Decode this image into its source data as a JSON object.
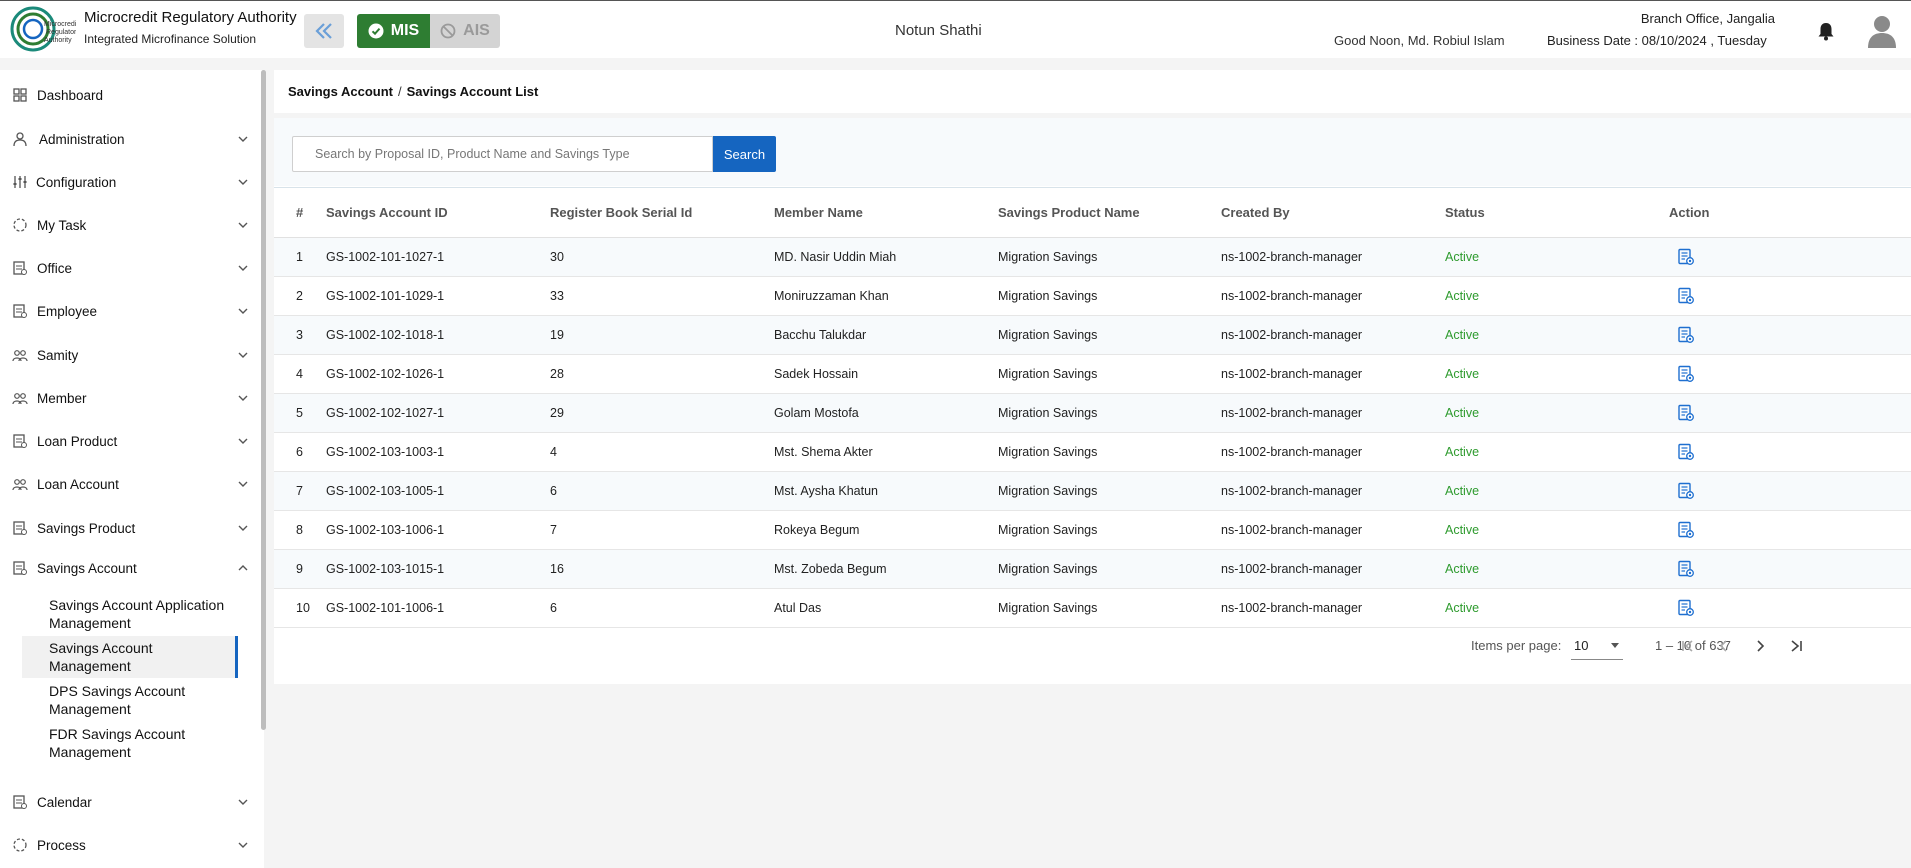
{
  "header": {
    "brand_title": "Microcredit Regulatory Authority",
    "brand_sub": "Integrated Microfinance Solution",
    "logo_text": "Microcredit Regulatory Authority",
    "mis_label": "MIS",
    "ais_label": "AIS",
    "org_name": "Notun Shathi",
    "greeting": "Good Noon, Md. Robiul Islam",
    "branch": "Branch Office, Jangalia",
    "business_date": "Business Date : 08/10/2024 , Tuesday",
    "colors": {
      "mis": "#2e7d32",
      "primary": "#1565c0"
    }
  },
  "sidebar": {
    "items": [
      {
        "label": "Dashboard",
        "icon": "dashboard-icon"
      },
      {
        "label": "Administration",
        "icon": "admin-icon"
      },
      {
        "label": "Configuration",
        "icon": "config-icon"
      },
      {
        "label": "My Task",
        "icon": "task-icon"
      },
      {
        "label": "Office",
        "icon": "office-icon"
      },
      {
        "label": "Employee",
        "icon": "employee-icon"
      },
      {
        "label": "Samity",
        "icon": "samity-icon"
      },
      {
        "label": "Member",
        "icon": "member-icon"
      },
      {
        "label": "Loan Product",
        "icon": "loan-product-icon"
      },
      {
        "label": "Loan Account",
        "icon": "loan-account-icon"
      },
      {
        "label": "Savings Product",
        "icon": "savings-product-icon"
      },
      {
        "label": "Savings Account",
        "icon": "savings-account-icon"
      },
      {
        "label": "Calendar",
        "icon": "calendar-icon"
      },
      {
        "label": "Process",
        "icon": "process-icon"
      }
    ],
    "sub_items": [
      "Savings Account Application Management",
      "Savings Account Management",
      "DPS Savings Account Management",
      "FDR Savings Account Management"
    ]
  },
  "breadcrumb": {
    "parent": "Savings Account",
    "separator": "/",
    "current": "Savings Account List"
  },
  "search": {
    "placeholder": "Search by Proposal ID, Product Name and Savings Type",
    "value": "",
    "button": "Search"
  },
  "table": {
    "headers": [
      "#",
      "Savings Account ID",
      "Register Book Serial Id",
      "Member Name",
      "Savings Product Name",
      "Created By",
      "Status",
      "Action"
    ],
    "rows": [
      [
        "1",
        "GS-1002-101-1027-1",
        "30",
        "MD. Nasir Uddin Miah",
        "Migration Savings",
        "ns-1002-branch-manager",
        "Active"
      ],
      [
        "2",
        "GS-1002-101-1029-1",
        "33",
        "Moniruzzaman Khan",
        "Migration Savings",
        "ns-1002-branch-manager",
        "Active"
      ],
      [
        "3",
        "GS-1002-102-1018-1",
        "19",
        "Bacchu Talukdar",
        "Migration Savings",
        "ns-1002-branch-manager",
        "Active"
      ],
      [
        "4",
        "GS-1002-102-1026-1",
        "28",
        "Sadek Hossain",
        "Migration Savings",
        "ns-1002-branch-manager",
        "Active"
      ],
      [
        "5",
        "GS-1002-102-1027-1",
        "29",
        "Golam Mostofa",
        "Migration Savings",
        "ns-1002-branch-manager",
        "Active"
      ],
      [
        "6",
        "GS-1002-103-1003-1",
        "4",
        "Mst. Shema Akter",
        "Migration Savings",
        "ns-1002-branch-manager",
        "Active"
      ],
      [
        "7",
        "GS-1002-103-1005-1",
        "6",
        "Mst. Aysha Khatun",
        "Migration Savings",
        "ns-1002-branch-manager",
        "Active"
      ],
      [
        "8",
        "GS-1002-103-1006-1",
        "7",
        "Rokeya Begum",
        "Migration Savings",
        "ns-1002-branch-manager",
        "Active"
      ],
      [
        "9",
        "GS-1002-103-1015-1",
        "16",
        "Mst. Zobeda Begum",
        "Migration Savings",
        "ns-1002-branch-manager",
        "Active"
      ],
      [
        "10",
        "GS-1002-101-1006-1",
        "6",
        "Atul Das",
        "Migration Savings",
        "ns-1002-branch-manager",
        "Active"
      ]
    ]
  },
  "pagination": {
    "items_per_page_label": "Items per page:",
    "items_per_page": "10",
    "range": "1 – 10 of 637"
  }
}
